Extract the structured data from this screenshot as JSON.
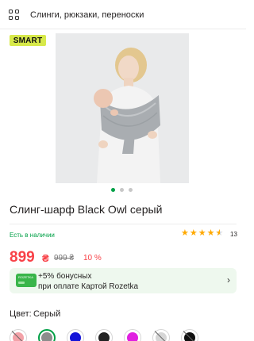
{
  "header": {
    "breadcrumb": "Слинги, рюкзаки, переноски"
  },
  "brand": {
    "logo_text": "SMART"
  },
  "gallery": {
    "image_alt": "Слинг-шарф Black Owl серый",
    "current_slide": 1,
    "total_slides": 3
  },
  "product": {
    "title": "Слинг-шарф Black Owl серый",
    "availability": "Есть в наличии",
    "rating": 4.5,
    "reviews_count": "13"
  },
  "price": {
    "current": "899",
    "currency": "₴",
    "old": "999 ₴",
    "discount": "10 %"
  },
  "bonus": {
    "card_tag": "ROZETKA",
    "line1": "+5% бонусных",
    "line2": "при оплате Картой Rozetka"
  },
  "color": {
    "label": "Цвет:",
    "value": "Серый",
    "swatches": [
      {
        "name": "pink",
        "hex": "#f3a2a8",
        "available": false,
        "selected": false
      },
      {
        "name": "gray",
        "hex": "#8c8c8c",
        "available": true,
        "selected": true
      },
      {
        "name": "blue",
        "hex": "#1414d8",
        "available": true,
        "selected": false
      },
      {
        "name": "black",
        "hex": "#222222",
        "available": true,
        "selected": false
      },
      {
        "name": "magenta",
        "hex": "#e020e0",
        "available": true,
        "selected": false
      },
      {
        "name": "light-gray",
        "hex": "#d6d6d6",
        "available": false,
        "selected": false
      },
      {
        "name": "black-2",
        "hex": "#111111",
        "available": false,
        "selected": false
      }
    ]
  },
  "theme": {
    "accent_green": "#00a046",
    "price_red": "#f84147",
    "star_yellow": "#ffa900"
  }
}
